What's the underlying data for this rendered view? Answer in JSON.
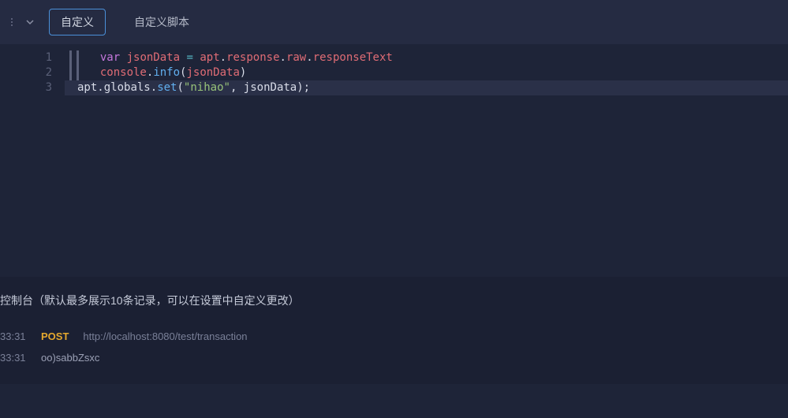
{
  "tabs": {
    "custom": "自定义",
    "custom_script": "自定义脚本"
  },
  "code": {
    "line_numbers": [
      "1",
      "2",
      "3"
    ],
    "line1": {
      "indent": "  ",
      "kw": "var",
      "sp1": " ",
      "name": "jsonData",
      "sp2": " ",
      "eq": "=",
      "sp3": " ",
      "p1": "apt",
      "d1": ".",
      "p2": "response",
      "d2": ".",
      "p3": "raw",
      "d3": ".",
      "p4": "responseText"
    },
    "line2": {
      "indent": "  ",
      "obj": "console",
      "d1": ".",
      "fn": "info",
      "lp": "(",
      "arg": "jsonData",
      "rp": ")"
    },
    "line3": {
      "p1": "apt",
      "d1": ".",
      "p2": "globals",
      "d2": ".",
      "fn": "set",
      "lp": "(",
      "str": "\"nihao\"",
      "comma": ", ",
      "arg": "jsonData",
      "rp": ")",
      "semi": ";"
    }
  },
  "console": {
    "header_prefix": "控制台",
    "header_note": "（默认最多展示10条记录，可以在设置中自定义更改）",
    "rows": [
      {
        "time": "33:31",
        "method": "POST",
        "url": "http://localhost:8080/test/transaction"
      },
      {
        "time": "33:31",
        "text": "oo)sabbZsxc"
      }
    ]
  }
}
